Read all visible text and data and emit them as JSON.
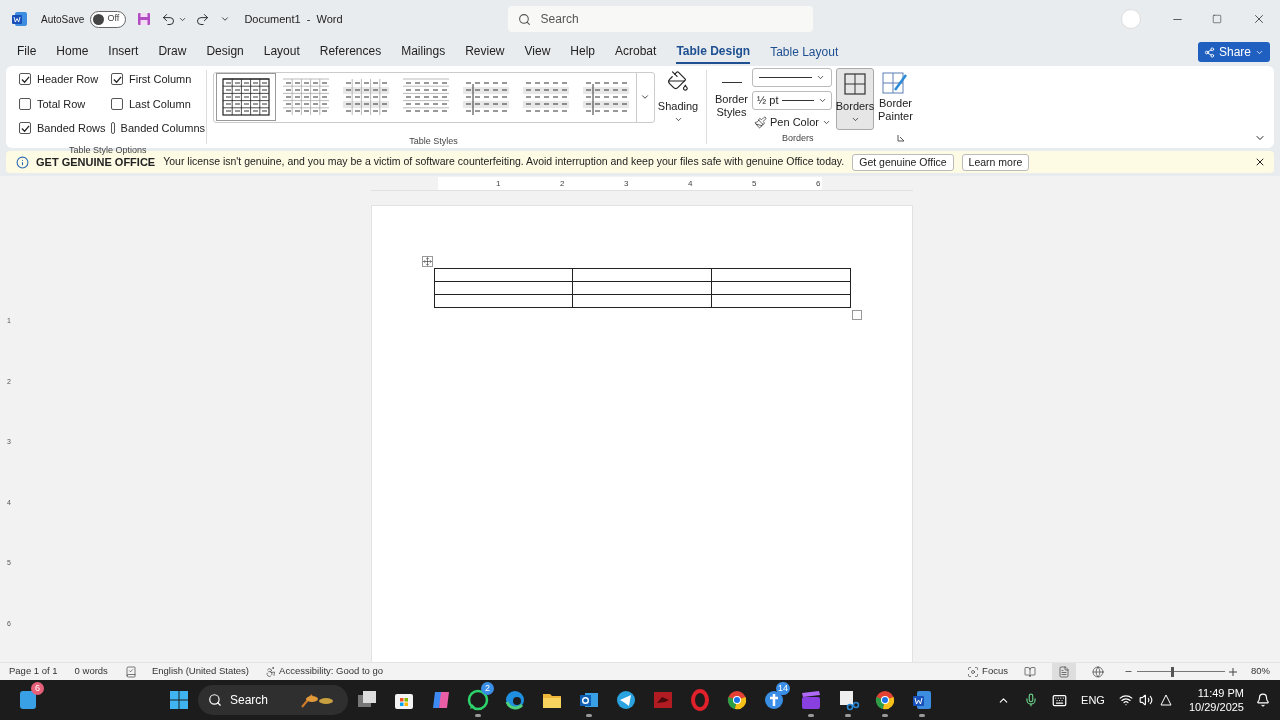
{
  "title_bar": {
    "autosave": {
      "label": "AutoSave",
      "on": false,
      "state_text": "Off"
    },
    "document_title": "Document1  -  Word",
    "search": {
      "placeholder": "Search"
    }
  },
  "menu_tabs": [
    {
      "label": "File",
      "selected": false
    },
    {
      "label": "Home",
      "selected": false
    },
    {
      "label": "Insert",
      "selected": false
    },
    {
      "label": "Draw",
      "selected": false
    },
    {
      "label": "Design",
      "selected": false
    },
    {
      "label": "Layout",
      "selected": false
    },
    {
      "label": "References",
      "selected": false
    },
    {
      "label": "Mailings",
      "selected": false
    },
    {
      "label": "Review",
      "selected": false
    },
    {
      "label": "View",
      "selected": false
    },
    {
      "label": "Help",
      "selected": false
    },
    {
      "label": "Acrobat",
      "selected": false
    },
    {
      "label": "Table Design",
      "selected": true
    },
    {
      "label": "Table Layout",
      "selected": false
    }
  ],
  "share_button": "Share",
  "ribbon": {
    "style_options": {
      "label": "Table Style Options",
      "options": [
        {
          "label": "Header Row",
          "checked": true
        },
        {
          "label": "First Column",
          "checked": true
        },
        {
          "label": "Total Row",
          "checked": false
        },
        {
          "label": "Last Column",
          "checked": false
        },
        {
          "label": "Banded Rows",
          "checked": true
        },
        {
          "label": "Banded Columns",
          "checked": false
        }
      ]
    },
    "table_styles": {
      "label": "Table Styles",
      "styles": [
        {
          "selected": true
        },
        {
          "selected": false
        },
        {
          "selected": false
        },
        {
          "selected": false
        },
        {
          "selected": false
        },
        {
          "selected": false
        },
        {
          "selected": false
        }
      ]
    },
    "shading": "Shading",
    "borders": {
      "label": "Borders",
      "border_styles": "Border Styles",
      "line_weight": "½ pt",
      "pen_color": "Pen Color",
      "borders_button": {
        "label": "Borders",
        "selected": true
      },
      "border_painter": "Border Painter"
    }
  },
  "info_bar": {
    "title": "GET GENUINE OFFICE",
    "message": "Your license isn't genuine, and you may be a victim of software counterfeiting. Avoid interruption and keep your files safe with genuine Office today.",
    "buttons": [
      "Get genuine Office",
      "Learn more"
    ]
  },
  "ruler": {
    "numbers": [
      "1",
      "2",
      "3",
      "4",
      "5",
      "6"
    ],
    "vertical_numbers": [
      "1",
      "2",
      "3",
      "4",
      "5",
      "6"
    ]
  },
  "status_bar": {
    "page": "Page 1 of 1",
    "words": "0 words",
    "language": "English (United States)",
    "accessibility": "Accessibility: Good to go",
    "focus": "Focus",
    "views": [
      {
        "kind": "read",
        "selected": false
      },
      {
        "kind": "print",
        "selected": true
      },
      {
        "kind": "web",
        "selected": false
      }
    ],
    "zoom": {
      "level": 0.4,
      "reading": "80%"
    }
  },
  "taskbar": {
    "search_placeholder": "Search",
    "apps": [
      {
        "kind": "widgets",
        "badge": "6",
        "running": false
      },
      {
        "kind": "start",
        "running": false
      },
      {
        "kind": "search"
      },
      {
        "kind": "taskview",
        "running": false
      },
      {
        "kind": "store",
        "running": false
      },
      {
        "kind": "copilot",
        "running": false
      },
      {
        "kind": "whatsapp",
        "badge": "2",
        "running": true
      },
      {
        "kind": "edge",
        "running": false
      },
      {
        "kind": "explorer",
        "running": false
      },
      {
        "kind": "outlook",
        "running": true
      },
      {
        "kind": "telegram",
        "running": false
      },
      {
        "kind": "redapp",
        "running": false
      },
      {
        "kind": "opera",
        "running": false
      },
      {
        "kind": "chrome",
        "running": false
      },
      {
        "kind": "plusapp",
        "badge": "14",
        "running": false
      },
      {
        "kind": "clapper",
        "running": true
      },
      {
        "kind": "snip",
        "running": true
      },
      {
        "kind": "chrome",
        "running": true
      },
      {
        "kind": "word",
        "running": true
      }
    ],
    "language": "ENG",
    "time": "11:49 PM",
    "date": "10/29/2025"
  }
}
